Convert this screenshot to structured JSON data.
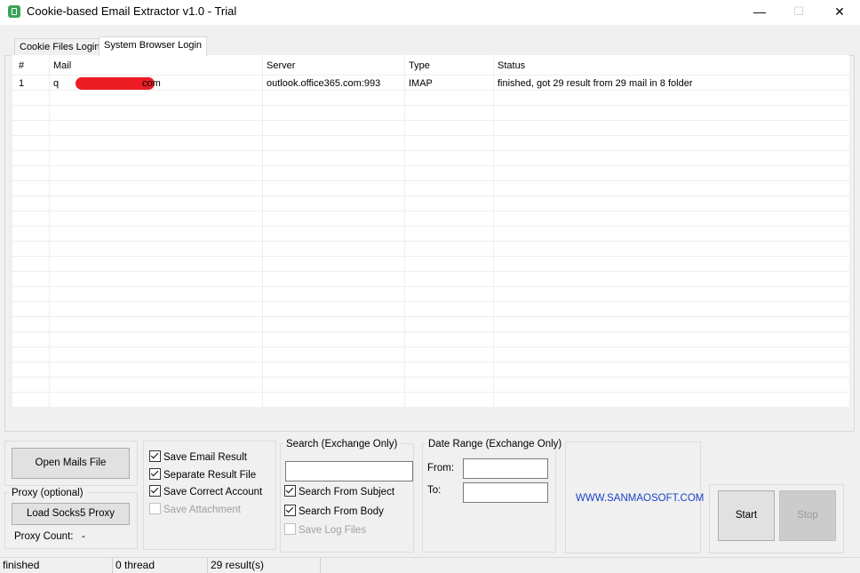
{
  "window": {
    "title": "Cookie-based Email Extractor v1.0 - Trial",
    "minimize": "—",
    "maximize": "☐",
    "close": "✕"
  },
  "tabs": [
    {
      "label": "Cookie Files Login",
      "active": false
    },
    {
      "label": "System Browser Login",
      "active": true
    }
  ],
  "grid": {
    "columns": [
      "#",
      "Mail",
      "Server",
      "Type",
      "Status"
    ],
    "rows": [
      {
        "num": "1",
        "mail_start": "q",
        "mail_end": "com",
        "server": "outlook.office365.com:993",
        "type": "IMAP",
        "status": "finished, got 29 result from 29 mail in 8 folder"
      }
    ]
  },
  "left_panel": {
    "open_mails_button": "Open Mails File",
    "proxy_group_label": "Proxy (optional)",
    "load_proxy_button": "Load Socks5 Proxy",
    "proxy_count_label": "Proxy Count:",
    "proxy_count_value": "-"
  },
  "options": {
    "save_email_result": "Save Email Result",
    "separate_result_file": "Separate Result File",
    "save_correct_account": "Save Correct Account",
    "save_attachment": "Save Attachment"
  },
  "search": {
    "group_label": "Search (Exchange Only)",
    "input_value": "",
    "search_from_subject": "Search From Subject",
    "search_from_body": "Search From Body",
    "save_log_files": "Save Log Files"
  },
  "date_range": {
    "group_label": "Date Range (Exchange Only)",
    "from_label": "From:",
    "to_label": "To:",
    "from_value": "",
    "to_value": ""
  },
  "website": {
    "link": "WWW.SANMAOSOFT.COM",
    "color": "#1a3fc8"
  },
  "actions": {
    "start": "Start",
    "stop": "Stop"
  },
  "status_bar": {
    "state": "finished",
    "threads": "0 thread",
    "results": "29 result(s)"
  },
  "colors": {
    "accent_icon": "#3aa357",
    "redaction": "#ed1c24"
  }
}
